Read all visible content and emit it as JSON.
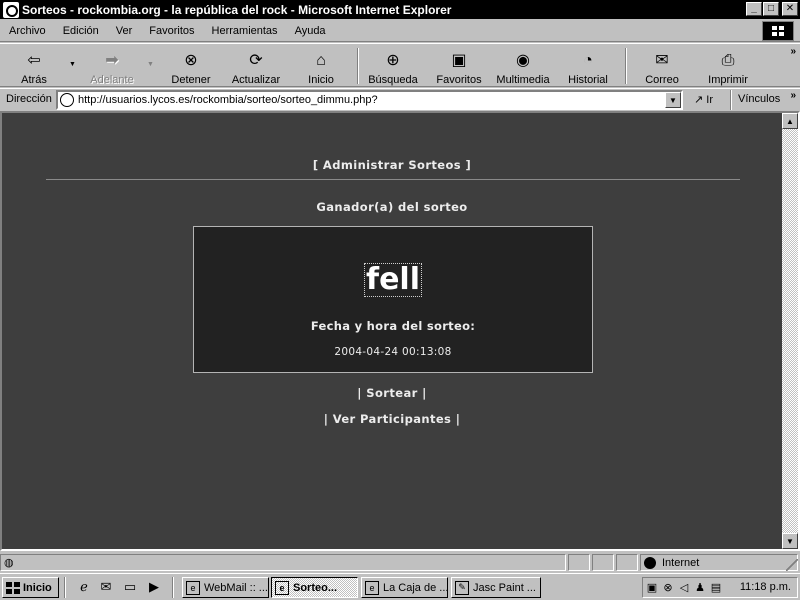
{
  "window": {
    "title": "Sorteos - rockombia.org - la república del rock - Microsoft Internet Explorer",
    "minimize": "_",
    "maximize": "□",
    "close": "✕"
  },
  "menu": {
    "items": [
      {
        "label": "Archivo"
      },
      {
        "label": "Edición"
      },
      {
        "label": "Ver"
      },
      {
        "label": "Favoritos"
      },
      {
        "label": "Herramientas"
      },
      {
        "label": "Ayuda"
      }
    ]
  },
  "toolbar": {
    "back": {
      "label": "Atrás",
      "icon": "back-arrow-icon",
      "glyph": "⇦"
    },
    "forward": {
      "label": "Adelante",
      "icon": "forward-arrow-icon",
      "glyph": "➡"
    },
    "stop": {
      "label": "Detener",
      "icon": "stop-icon",
      "glyph": "⊗"
    },
    "refresh": {
      "label": "Actualizar",
      "icon": "refresh-icon",
      "glyph": "⟳"
    },
    "home": {
      "label": "Inicio",
      "icon": "home-icon",
      "glyph": "⌂"
    },
    "search": {
      "label": "Búsqueda",
      "icon": "search-icon",
      "glyph": "⊕"
    },
    "favorites": {
      "label": "Favoritos",
      "icon": "favorites-icon",
      "glyph": "▣"
    },
    "media": {
      "label": "Multimedia",
      "icon": "media-icon",
      "glyph": "◉"
    },
    "history": {
      "label": "Historial",
      "icon": "history-icon",
      "glyph": "◔"
    },
    "mail": {
      "label": "Correo",
      "icon": "mail-icon",
      "glyph": "✉"
    },
    "print": {
      "label": "Imprimir",
      "icon": "print-icon",
      "glyph": "⎙"
    },
    "more": "»"
  },
  "address": {
    "label": "Dirección",
    "url": "http://usuarios.lycos.es/rockombia/sorteo/sorteo_dimmu.php?",
    "go_label": "Ir",
    "links_label": "Vínculos",
    "more": "»"
  },
  "page": {
    "admin_link": "[ Administrar Sorteos ]",
    "winner_heading": "Ganador(a) del sorteo",
    "winner_name": "fell",
    "date_label": "Fecha y hora del sorteo:",
    "date_value": "2004-04-24 00:13:08",
    "sortear_link": "| Sortear |",
    "participants_link": "| Ver Participantes |"
  },
  "status": {
    "zone": "Internet"
  },
  "taskbar": {
    "start_label": "Inicio",
    "tasks": [
      {
        "label": "WebMail :: ...",
        "active": false
      },
      {
        "label": "Sorteo...",
        "active": true
      },
      {
        "label": "La Caja de ...",
        "active": false
      },
      {
        "label": "Jasc Paint ...",
        "active": false
      }
    ],
    "clock": "11:18 p.m."
  },
  "colors": {
    "page_background": "#3e3e3e",
    "winner_box_background": "#222222",
    "titlebar_background": "#000000"
  }
}
